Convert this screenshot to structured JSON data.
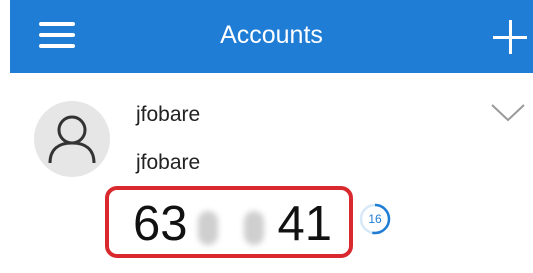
{
  "header": {
    "title": "Accounts",
    "menu_icon": "hamburger-menu-icon",
    "add_icon": "plus-icon",
    "background_color": "#1f7dd6"
  },
  "account": {
    "name": "jfobare",
    "username": "jfobare",
    "avatar_icon": "user-silhouette-icon",
    "expand_icon": "chevron-down-icon",
    "code_prefix": "63",
    "code_suffix": "41",
    "code_masked": true,
    "timer_seconds": "16",
    "timer_progress_fraction": 0.53,
    "highlight_color": "#d9292f",
    "accent_color": "#1f7dd6"
  }
}
